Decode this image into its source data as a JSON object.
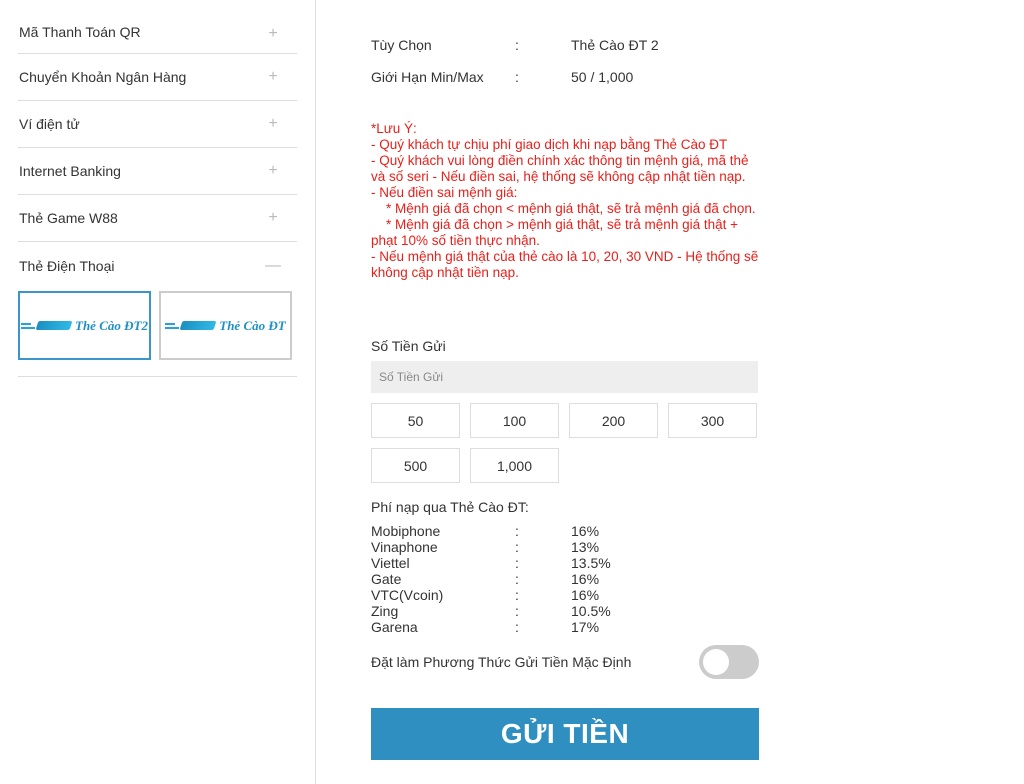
{
  "sidebar": {
    "items": [
      {
        "label": "Mã Thanh Toán QR",
        "toggle": "+"
      },
      {
        "label": "Chuyển Khoản Ngân Hàng",
        "toggle": "+"
      },
      {
        "label": "Ví điện tử",
        "toggle": "+"
      },
      {
        "label": "Internet Banking",
        "toggle": "+"
      },
      {
        "label": "Thẻ Game W88",
        "toggle": "+"
      },
      {
        "label": "Thẻ Điện Thoại",
        "toggle": "—"
      }
    ],
    "card_options": [
      {
        "label": "Thẻ Cào ĐT2",
        "selected": true
      },
      {
        "label": "Thẻ Cào ĐT",
        "selected": false
      }
    ]
  },
  "main": {
    "option_label": "Tùy Chọn",
    "option_colon": ":",
    "option_value": "Thẻ Cào ĐT 2",
    "limit_label": "Giới Hạn Min/Max",
    "limit_colon": ":",
    "limit_value": "50 / 1,000",
    "note": "*Lưu Ý:\n- Quý khách tự chịu phí giao dịch khi nạp bằng Thẻ Cào ĐT\n- Quý khách vui lòng điền chính xác thông tin mệnh giá, mã thẻ và số seri - Nếu điền sai, hệ thống sẽ không cập nhật tiền nạp.\n- Nếu điền sai mệnh giá:\n    * Mệnh giá đã chọn < mệnh giá thật, sẽ trả mệnh giá đã chọn.\n    * Mệnh giá đã chọn > mệnh giá thật, sẽ trả mệnh giá thật + phạt 10% số tiền thực nhận.\n- Nếu mệnh giá thật của thẻ cào là 10, 20, 30 VND - Hệ thống sẽ không cập nhật tiền nạp.",
    "amount_label": "Số Tiền Gửi",
    "amount_placeholder": "Số Tiền Gửi",
    "amount_value": "",
    "chips": [
      "50",
      "100",
      "200",
      "300",
      "500",
      "1,000"
    ],
    "fee_title": "Phí nạp qua Thẻ Cào ĐT:",
    "fees": [
      {
        "name": "Mobiphone",
        "colon": ":",
        "rate": "16%"
      },
      {
        "name": "Vinaphone",
        "colon": ":",
        "rate": "13%"
      },
      {
        "name": "Viettel",
        "colon": ":",
        "rate": "13.5%"
      },
      {
        "name": "Gate",
        "colon": ":",
        "rate": "16%"
      },
      {
        "name": "VTC(Vcoin)",
        "colon": ":",
        "rate": "16%"
      },
      {
        "name": "Zing",
        "colon": ":",
        "rate": "10.5%"
      },
      {
        "name": "Garena",
        "colon": ":",
        "rate": "17%"
      }
    ],
    "default_label": "Đặt làm Phương Thức Gửi Tiền Mặc Định",
    "default_on": false,
    "submit_label": "GỬI TIỀN"
  },
  "colors": {
    "accent": "#2f8fc0",
    "note_red": "#e8201b",
    "selected_border": "#3a96c8"
  }
}
